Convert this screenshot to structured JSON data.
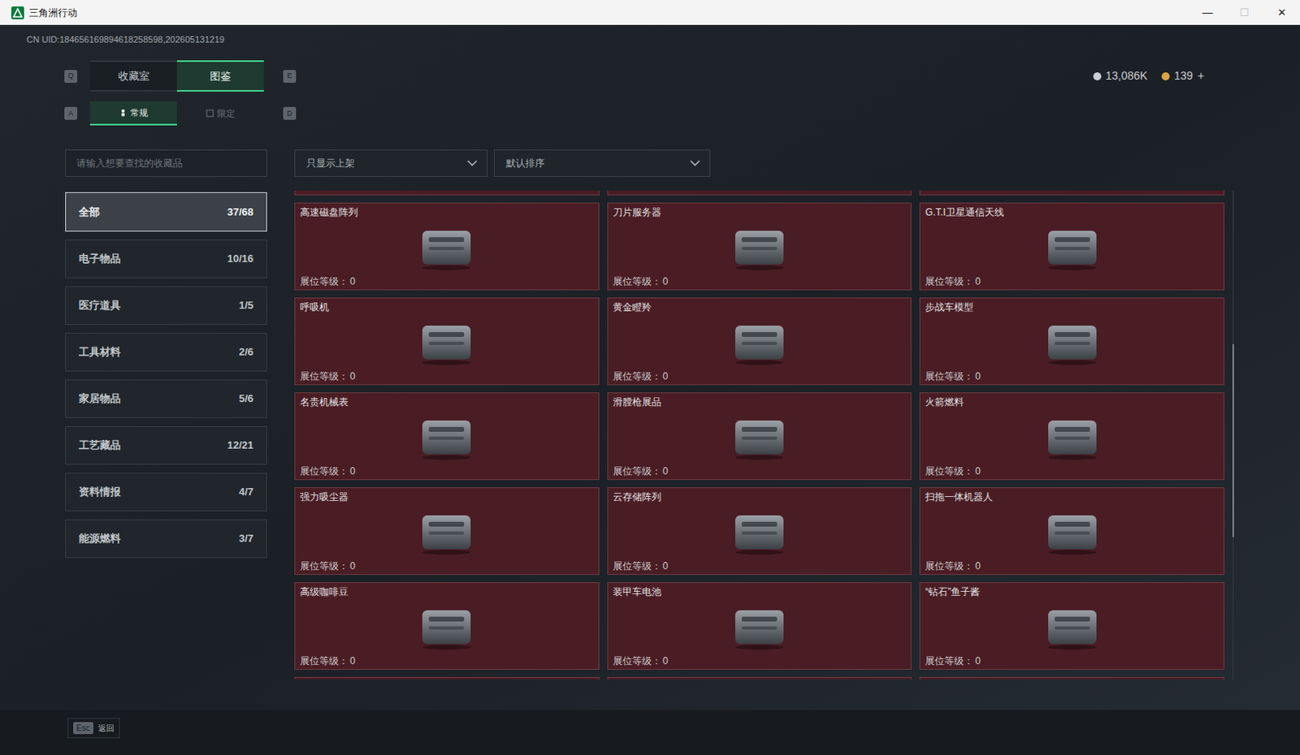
{
  "window": {
    "title": "三角洲行动",
    "controls": [
      "—",
      "☐",
      "✕"
    ]
  },
  "uid": "CN UID:184656169894618258598,202605131219",
  "currency": [
    {
      "amount": "13,086K",
      "color": "#c9ccd0"
    },
    {
      "amount": "139",
      "color": "#d9a441"
    }
  ],
  "currency_add": "+",
  "tab_keys": [
    "Q",
    "E"
  ],
  "tabs": [
    {
      "label": "收藏室",
      "selected": false
    },
    {
      "label": "图鉴",
      "selected": true
    }
  ],
  "subtab_keys": [
    "A",
    "D"
  ],
  "subtabs": [
    {
      "label": "常规",
      "selected": true
    },
    {
      "label": "限定",
      "selected": false
    }
  ],
  "search": {
    "placeholder": "请输入想要查找的收藏品"
  },
  "filters": [
    {
      "label": "只显示上架"
    },
    {
      "label": "默认排序"
    }
  ],
  "sidebar": {
    "items": [
      {
        "label": "全部",
        "count": "37/68",
        "selected": true
      },
      {
        "label": "电子物品",
        "count": "10/16",
        "selected": false
      },
      {
        "label": "医疗道具",
        "count": "1/5",
        "selected": false
      },
      {
        "label": "工具材料",
        "count": "2/6",
        "selected": false
      },
      {
        "label": "家居物品",
        "count": "5/6",
        "selected": false
      },
      {
        "label": "工艺藏品",
        "count": "12/21",
        "selected": false
      },
      {
        "label": "资料情报",
        "count": "4/7",
        "selected": false
      },
      {
        "label": "能源燃料",
        "count": "3/7",
        "selected": false
      }
    ]
  },
  "grid": {
    "level_label": "展位等级：",
    "items": [
      {
        "name": "高速磁盘阵列",
        "booth_level": "0"
      },
      {
        "name": "刀片服务器",
        "booth_level": "0"
      },
      {
        "name": "G.T.I卫星通信天线",
        "booth_level": "0"
      },
      {
        "name": "呼吸机",
        "booth_level": "0"
      },
      {
        "name": "黄金瞪羚",
        "booth_level": "0"
      },
      {
        "name": "步战车模型",
        "booth_level": "0"
      },
      {
        "name": "名贵机械表",
        "booth_level": "0"
      },
      {
        "name": "滑膛枪展品",
        "booth_level": "0"
      },
      {
        "name": "火箭燃料",
        "booth_level": "0"
      },
      {
        "name": "强力吸尘器",
        "booth_level": "0"
      },
      {
        "name": "云存储阵列",
        "booth_level": "0"
      },
      {
        "name": "扫拖一体机器人",
        "booth_level": "0"
      },
      {
        "name": "高级咖啡豆",
        "booth_level": "0"
      },
      {
        "name": "装甲车电池",
        "booth_level": "0"
      },
      {
        "name": "“钻石”鱼子酱",
        "booth_level": "0"
      }
    ]
  },
  "scrollbar": {
    "level": 0.52
  },
  "footer": {
    "key": "Esc",
    "label": "返回"
  }
}
